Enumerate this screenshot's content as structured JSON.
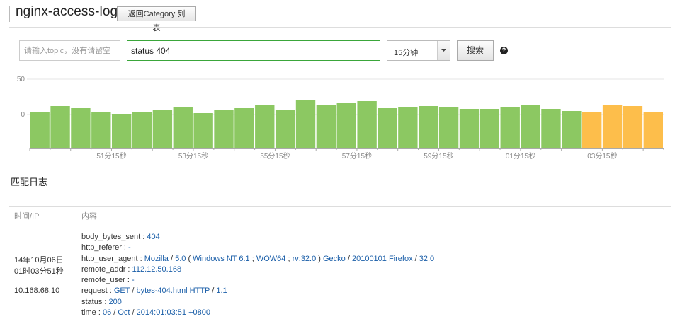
{
  "header": {
    "title": "nginx-access-log",
    "back_label": "返回Category 列表"
  },
  "search": {
    "topic_placeholder": "请输入topic，没有请留空",
    "query_value": "status 404",
    "range_value": "15分钟",
    "search_label": "搜索",
    "help_symbol": "?"
  },
  "colors": {
    "bar_normal": "#8cc862",
    "bar_highlight": "#fdbe4b",
    "query_border": "#3aa63a",
    "link": "#1a5ea8"
  },
  "chart_data": {
    "type": "bar",
    "ylim": [
      -50,
      50
    ],
    "yticks": [
      "50",
      "0"
    ],
    "xtick_labels": [
      "51分15秒",
      "53分15秒",
      "55分15秒",
      "57分15秒",
      "59分15秒",
      "01分15秒",
      "03分15秒"
    ],
    "values": [
      3,
      12,
      9,
      3,
      1,
      3,
      6,
      11,
      2,
      6,
      9,
      13,
      7,
      21,
      14,
      17,
      19,
      9,
      10,
      12,
      11,
      8,
      8,
      11,
      13,
      8,
      5,
      4,
      13,
      12,
      4
    ],
    "highlight_from_index": 27,
    "grid": true
  },
  "results": {
    "section_title": "匹配日志",
    "col_time": "时间/IP",
    "col_content": "内容",
    "entry": {
      "date": "14年10月06日",
      "time": "01时03分51秒",
      "ip": "10.168.68.10",
      "lines": [
        {
          "key": "body_bytes_sent",
          "tokens": [
            {
              "t": "v",
              "s": "404"
            }
          ]
        },
        {
          "key": "http_referer",
          "tokens": [
            {
              "t": "v",
              "s": "-"
            }
          ]
        },
        {
          "key": "http_user_agent",
          "tokens": [
            {
              "t": "v",
              "s": "Mozilla"
            },
            {
              "t": "p",
              "s": " / "
            },
            {
              "t": "v",
              "s": "5.0"
            },
            {
              "t": "p",
              "s": " ( "
            },
            {
              "t": "v",
              "s": "Windows NT 6.1"
            },
            {
              "t": "p",
              "s": " ; "
            },
            {
              "t": "v",
              "s": "WOW64"
            },
            {
              "t": "p",
              "s": " ; "
            },
            {
              "t": "v",
              "s": "rv:32.0"
            },
            {
              "t": "p",
              "s": " ) "
            },
            {
              "t": "v",
              "s": "Gecko"
            },
            {
              "t": "p",
              "s": " / "
            },
            {
              "t": "v",
              "s": "20100101 Firefox"
            },
            {
              "t": "p",
              "s": " / "
            },
            {
              "t": "v",
              "s": "32.0"
            }
          ]
        },
        {
          "key": "remote_addr",
          "tokens": [
            {
              "t": "v",
              "s": "112.12.50.168"
            }
          ]
        },
        {
          "key": "remote_user",
          "tokens": [
            {
              "t": "v",
              "s": "-"
            }
          ]
        },
        {
          "key": "request",
          "tokens": [
            {
              "t": "v",
              "s": "GET"
            },
            {
              "t": "p",
              "s": " / "
            },
            {
              "t": "v",
              "s": "bytes-404.html HTTP"
            },
            {
              "t": "p",
              "s": " / "
            },
            {
              "t": "v",
              "s": "1.1"
            }
          ]
        },
        {
          "key": "status",
          "tokens": [
            {
              "t": "v",
              "s": "200"
            }
          ]
        },
        {
          "key": "time",
          "tokens": [
            {
              "t": "v",
              "s": "06"
            },
            {
              "t": "p",
              "s": " / "
            },
            {
              "t": "v",
              "s": "Oct"
            },
            {
              "t": "p",
              "s": " / "
            },
            {
              "t": "v",
              "s": "2014:01:03:51 +0800"
            }
          ]
        }
      ]
    }
  }
}
